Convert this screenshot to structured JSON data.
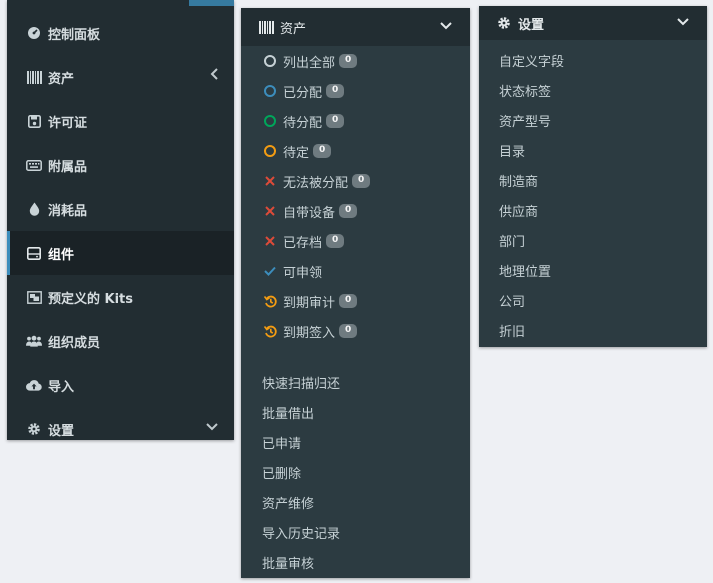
{
  "left_sidebar": {
    "items": [
      {
        "label": "控制面板"
      },
      {
        "label": "资产"
      },
      {
        "label": "许可证"
      },
      {
        "label": "附属品"
      },
      {
        "label": "消耗品"
      },
      {
        "label": "组件"
      },
      {
        "label": "预定义的 Kits"
      },
      {
        "label": "组织成员"
      },
      {
        "label": "导入"
      },
      {
        "label": "设置"
      }
    ]
  },
  "assets_menu": {
    "title": "资产",
    "status_items": [
      {
        "label": "列出全部",
        "count": "0",
        "icon": "circle-icon"
      },
      {
        "label": "已分配",
        "count": "0",
        "icon": "circle-blue-icon"
      },
      {
        "label": "待分配",
        "count": "0",
        "icon": "circle-green-icon"
      },
      {
        "label": "待定",
        "count": "0",
        "icon": "circle-orange-icon"
      },
      {
        "label": "无法被分配",
        "count": "0",
        "icon": "x-icon"
      },
      {
        "label": "自带设备",
        "count": "0",
        "icon": "x-icon"
      },
      {
        "label": "已存档",
        "count": "0",
        "icon": "x-icon"
      },
      {
        "label": "可申领",
        "icon": "check-icon"
      },
      {
        "label": "到期审计",
        "count": "0",
        "icon": "history-icon"
      },
      {
        "label": "到期签入",
        "count": "0",
        "icon": "history-icon"
      }
    ],
    "other_items": [
      "快速扫描归还",
      "批量借出",
      "已申请",
      "已删除",
      "资产维修",
      "导入历史记录",
      "批量审核"
    ]
  },
  "settings_menu": {
    "title": "设置",
    "items": [
      "自定义字段",
      "状态标签",
      "资产型号",
      "目录",
      "制造商",
      "供应商",
      "部门",
      "地理位置",
      "公司",
      "折旧"
    ]
  },
  "colors": {
    "sidebar_bg": "#222d32",
    "submenu_bg": "#2c3b41",
    "accent": "#3c8dbc",
    "blue": "#3c8dbc",
    "green": "#00a65a",
    "orange": "#f39c12",
    "red": "#dd4b39"
  }
}
